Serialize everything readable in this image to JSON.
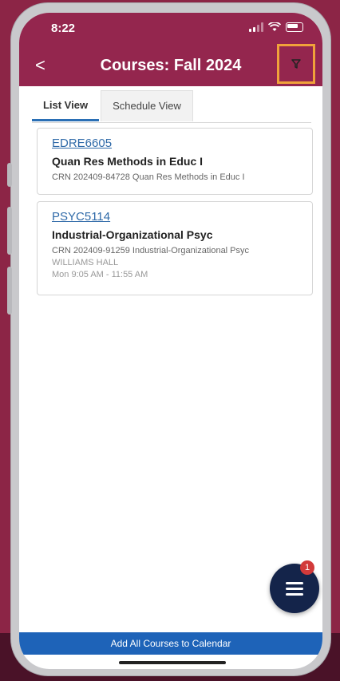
{
  "status": {
    "time": "8:22"
  },
  "header": {
    "title": "Courses: Fall 2024",
    "back_label": "<"
  },
  "tabs": [
    {
      "label": "List View",
      "active": true
    },
    {
      "label": "Schedule View",
      "active": false
    }
  ],
  "courses": [
    {
      "code": "EDRE6605",
      "name": "Quan Res Methods in Educ I",
      "crn": "CRN 202409-84728 Quan Res Methods in Educ I"
    },
    {
      "code": "PSYC5114",
      "name": "Industrial-Organizational Psyc",
      "crn": "CRN 202409-91259 Industrial-Organizational Psyc",
      "location": "WILLIAMS HALL",
      "time": "Mon 9:05 AM - 11:55 AM"
    }
  ],
  "fab": {
    "badge": "1",
    "icon": "menu-icon"
  },
  "footer": {
    "button_label": "Add All Courses to Calendar"
  },
  "colors": {
    "header": "#94264e",
    "accent": "#2f6aa8",
    "highlight": "#f0a23a",
    "fab": "#14244a"
  }
}
